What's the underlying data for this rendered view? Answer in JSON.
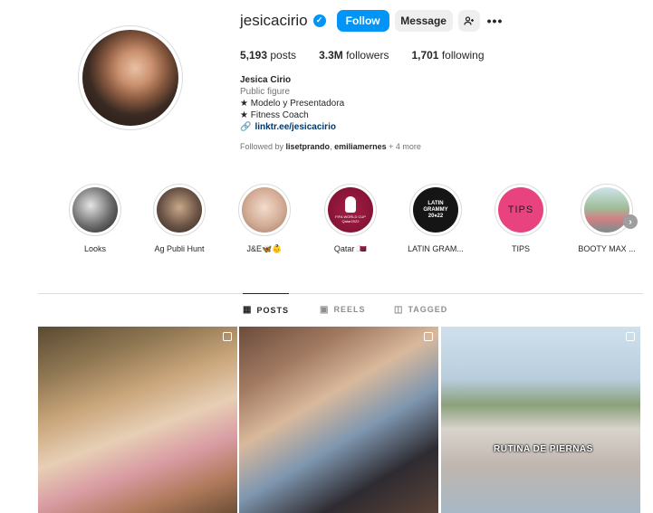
{
  "profile": {
    "username": "jesicacirio",
    "follow_label": "Follow",
    "message_label": "Message",
    "add_user_icon": "add-person-icon",
    "more_icon": "more-options-icon"
  },
  "stats": {
    "posts_count": "5,193",
    "posts_label": "posts",
    "followers_count": "3.3M",
    "followers_label": "followers",
    "following_count": "1,701",
    "following_label": "following"
  },
  "bio": {
    "name": "Jesica Cirio",
    "category": "Public figure",
    "line1": "★ Modelo y Presentadora",
    "line2": "★ Fitness Coach",
    "link": "linktr.ee/jesicacirio"
  },
  "followed_by": {
    "prefix": "Followed by",
    "user1": "lisetprando",
    "user2": "emiliamernes",
    "more": "+ 4 more"
  },
  "highlights": [
    {
      "label": "Looks",
      "color": "#2b2b2b"
    },
    {
      "label": "Ag Publi Hunt",
      "color": "#5b4a3e"
    },
    {
      "label": "J&E🦋👶",
      "color": "#d7b8a5"
    },
    {
      "label": "Qatar 🇶🇦",
      "color": "#8b1538"
    },
    {
      "label": "LATIN GRAM...",
      "color": "#1a1a1a"
    },
    {
      "label": "TIPS",
      "color": "#e8437f"
    },
    {
      "label": "BOOTY MAX ...",
      "color": "#7fa2a6"
    }
  ],
  "highlight_texts": {
    "qatar_logo": "FIFA WORLD CUP Qatar2022",
    "latin_grammy": "LATIN GRAMMY 20♦22",
    "tips": "TIPS"
  },
  "tabs": [
    {
      "label": "POSTS",
      "icon": "grid-icon"
    },
    {
      "label": "REELS",
      "icon": "reels-icon"
    },
    {
      "label": "TAGGED",
      "icon": "tagged-icon"
    }
  ],
  "posts": {
    "caption3": "RUTINA DE PIERNAS"
  }
}
